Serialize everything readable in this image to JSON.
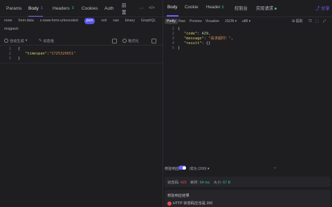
{
  "left": {
    "tabs": [
      {
        "label": "Params",
        "badge": ""
      },
      {
        "label": "Body",
        "badge": "1"
      },
      {
        "label": "Headers",
        "badge": "3"
      },
      {
        "label": "Cookies",
        "badge": ""
      },
      {
        "label": "Auth",
        "badge": ""
      },
      {
        "label": "前置",
        "badge": ""
      }
    ],
    "more_icon": "more-dots-icon",
    "code_icon": "code-brackets-icon",
    "body_types": [
      "none",
      "form-data",
      "x-www-form-urlencoded",
      "json",
      "xml",
      "raw",
      "binary",
      "GraphQL",
      "msgpack"
    ],
    "active_body_type": "json",
    "toolbar": {
      "auto_generate": "自动生成",
      "dynamic_value": "动态值",
      "format": "格式化"
    },
    "editor_lines": [
      "1",
      "2",
      "3"
    ],
    "editor_code": {
      "open": "{",
      "key": "\"timespan\"",
      "colon": ":",
      "value": "\"1725329651\"",
      "close": "}"
    }
  },
  "right": {
    "tabs": [
      {
        "label": "Body",
        "badge": ""
      },
      {
        "label": "Cookie",
        "badge": ""
      },
      {
        "label": "Header",
        "badge": "3"
      },
      {
        "label": "控制台",
        "badge": ""
      },
      {
        "label": "实际请求",
        "badge": ""
      }
    ],
    "share_label": "分享",
    "view_modes": [
      "Pretty",
      "Raw",
      "Preview",
      "Visualize"
    ],
    "active_view": "Pretty",
    "format_select": "JSON",
    "encoding_select": "utf8",
    "extract_label": "提取",
    "response_lines": [
      "1",
      "2",
      "3",
      "4",
      "5"
    ],
    "response_json": {
      "code_key": "\"code\"",
      "code_val": "429",
      "msg_key": "\"message\"",
      "msg_val": "\"请求超时！\"",
      "result_key": "\"result\"",
      "result_val": "{}"
    },
    "validate_label": "校验响应",
    "validate_result": "成功 (200)",
    "status": {
      "code_label": "状态码:",
      "code_value": "429",
      "time_label": "耗时:",
      "time_value": "54 ms",
      "size_label": "大小:",
      "size_value": "67 B"
    },
    "validation_title": "校验响应结果",
    "validation_item": "HTTP 状态码应当是 200"
  },
  "colors": {
    "accent": "#6b63ff",
    "error": "#e24d4d",
    "success": "#3fbf7f"
  }
}
